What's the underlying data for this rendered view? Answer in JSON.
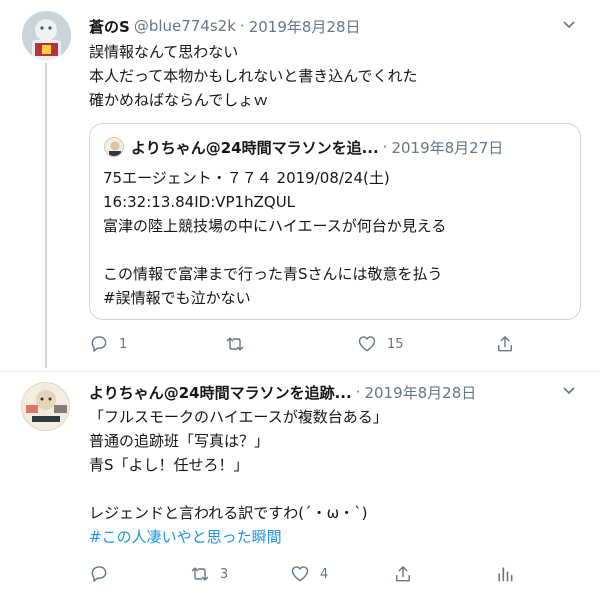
{
  "tweet1": {
    "name": "蒼のS",
    "handle": "@blue774s2k",
    "separator": "·",
    "date": "2019年8月28日",
    "lines": [
      "誤情報なんて思わない",
      "本人だって本物かもしれないと書き込んでくれた",
      "確かめねばならんでしょｗ"
    ],
    "quote": {
      "name": "よりちゃん@24時間マラソンを追...",
      "separator": "·",
      "date": "2019年8月27日",
      "lines": [
        "75エージェント・７７４ 2019/08/24(土)",
        "16:32:13.84ID:VP1hZQUL",
        "富津の陸上競技場の中にハイエースが何台か見える",
        "",
        "この情報で富津まで行った青Sさんには敬意を払う",
        "#誤情報でも泣かない"
      ]
    },
    "actions": {
      "reply_count": "1",
      "retweet_count": "",
      "like_count": "15"
    }
  },
  "tweet2": {
    "name": "よりちゃん@24時間マラソンを追跡...",
    "separator": "·",
    "date": "2019年8月28日",
    "lines": [
      "「フルスモークのハイエースが複数台ある」",
      "普通の追跡班「写真は？」",
      "青S「よし！任せろ！」",
      "",
      "レジェンドと言われる訳ですわ(´・ω・`)"
    ],
    "hashtag": "#この人凄いやと思った瞬間",
    "actions": {
      "reply_count": "",
      "retweet_count": "3",
      "like_count": "4"
    }
  },
  "icons": {
    "reply": "reply-icon",
    "retweet": "retweet-icon",
    "like": "like-icon",
    "share": "share-icon",
    "analytics": "analytics-icon",
    "caret": "chevron-down-icon"
  },
  "colors": {
    "text": "#14171a",
    "muted": "#657786",
    "link": "#1b95e0",
    "border": "#ccd6dd"
  }
}
